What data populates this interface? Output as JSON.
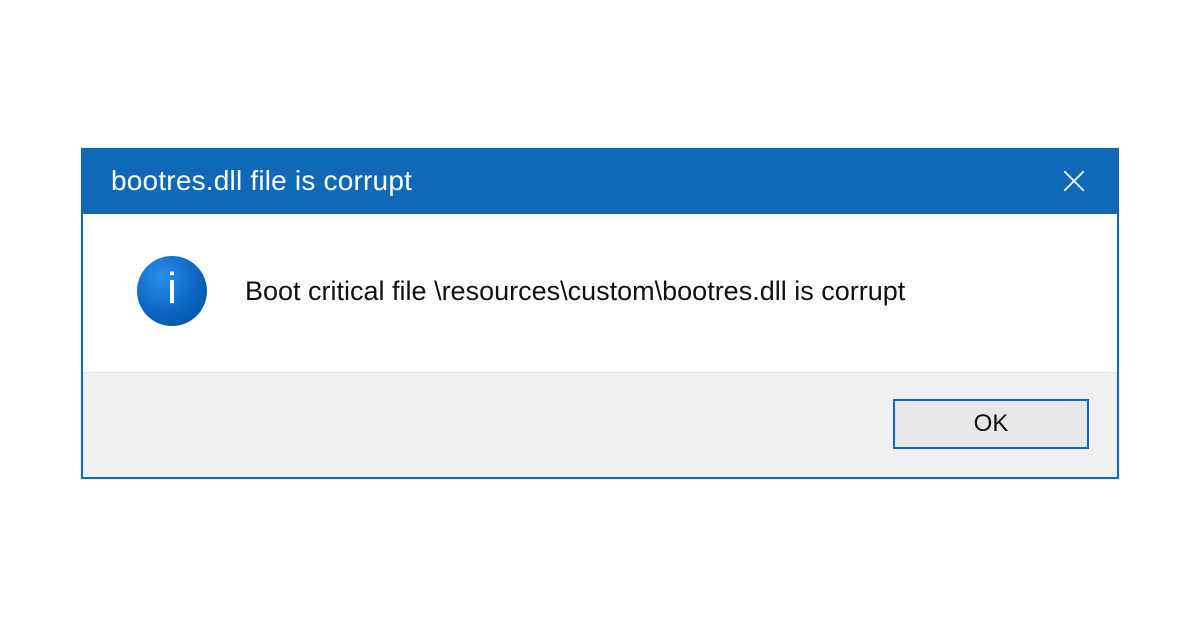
{
  "dialog": {
    "title": "bootres.dll file is corrupt",
    "message": "Boot critical file \\resources\\custom\\bootres.dll is corrupt",
    "ok_label": "OK",
    "info_glyph": "i"
  }
}
